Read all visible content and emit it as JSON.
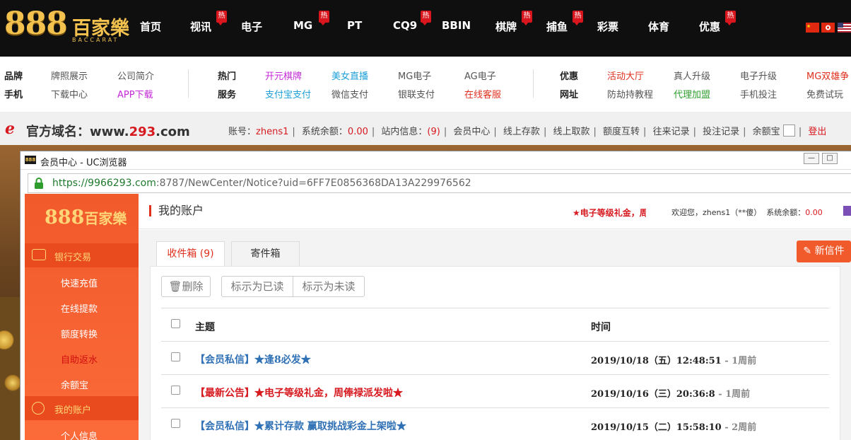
{
  "site": {
    "logo": {
      "number": "888",
      "cn": "百家樂",
      "en": "BACCARAT"
    },
    "hot_badge": "热",
    "nav": [
      {
        "label": "首页",
        "hot": false
      },
      {
        "label": "视讯",
        "hot": true
      },
      {
        "label": "电子",
        "hot": false
      },
      {
        "label": "MG",
        "hot": true
      },
      {
        "label": "PT",
        "hot": false
      },
      {
        "label": "CQ9",
        "hot": true
      },
      {
        "label": "BBIN",
        "hot": false
      },
      {
        "label": "棋牌",
        "hot": true
      },
      {
        "label": "捕鱼",
        "hot": true
      },
      {
        "label": "彩票",
        "hot": false
      },
      {
        "label": "体育",
        "hot": false
      },
      {
        "label": "优惠",
        "hot": true
      }
    ],
    "languages": [
      "zh-cn-flag-icon",
      "hk-flag-icon",
      "us-flag-icon"
    ]
  },
  "submenu": {
    "g1_row1": [
      "品牌",
      "牌照展示",
      "公司简介"
    ],
    "g1_row2": [
      "手机",
      "下载中心",
      "APP下载"
    ],
    "g2_row1": [
      "热门",
      "开元棋牌",
      "美女直播",
      "MG电子",
      "AG电子"
    ],
    "g2_row2": [
      "服务",
      "支付宝支付",
      "微信支付",
      "银联支付",
      "在线客服"
    ],
    "g3_row1": [
      "优惠",
      "活动大厅",
      "真人升级",
      "电子升级",
      "MG双雄争"
    ],
    "g3_row2": [
      "网址",
      "防劫持教程",
      "代理加盟",
      "手机投注",
      "免费试玩"
    ]
  },
  "account_bar": {
    "domain_label": "官方域名：",
    "domain_prefix": "www.",
    "domain_num": "293",
    "domain_suffix": ".com",
    "account_label": "账号：",
    "account_value": "zhens1",
    "balance_label": "系统余额：",
    "balance_value": "0.00",
    "messages_label": "站内信息：",
    "messages_value": "(9)",
    "links": [
      "会员中心",
      "线上存款",
      "线上取款",
      "额度互转",
      "往来记录",
      "投注记录",
      "余额宝"
    ],
    "logout": "登出"
  },
  "window": {
    "title": "会员中心 - UC浏览器",
    "url_domain": "https://9966293.com",
    "url_rest": ":8787/NewCenter/Notice?uid=6FF7E0856368DA13A229976562",
    "buttons": {
      "minimize": "—",
      "maximize": "□"
    }
  },
  "member": {
    "logo": {
      "number": "888",
      "cn": "百家樂"
    },
    "sidebar": {
      "group_bank": "银行交易",
      "bank_items": [
        "快速充值",
        "在线提款",
        "额度转换",
        "自助返水",
        "余额宝"
      ],
      "group_account": "我的账户",
      "account_items": [
        "个人信息"
      ]
    },
    "header": {
      "title": "我的账户",
      "marquee": "★电子等级礼金，周俸禄派发啦★",
      "welcome_prefix": "欢迎您，zhens1（**傻）",
      "balance_label": "系统余额：",
      "balance_value": "0.00"
    },
    "tabs": {
      "inbox": "收件箱 (9)",
      "sent": "寄件箱"
    },
    "new_mail": "新信件",
    "actions": {
      "delete": "删除",
      "mark_read": "标示为已读",
      "mark_unread": "标示为未读"
    },
    "table": {
      "col_subject": "主题",
      "col_time": "时间",
      "rows": [
        {
          "subject": "【会员私信】★逢8必发★",
          "time": "2019/10/18（五）12:48:51",
          "ago": " - 1周前",
          "color": "blue"
        },
        {
          "subject": "【最新公告】★电子等级礼金，周俸禄派发啦★",
          "time": "2019/10/16（三）20:36:8",
          "ago": " - 1周前",
          "color": "red"
        },
        {
          "subject": "【会员私信】★累计存款 赢取挑战彩金上架啦★",
          "time": "2019/10/15（二）15:58:10",
          "ago": " - 2周前",
          "color": "blue"
        }
      ]
    }
  }
}
